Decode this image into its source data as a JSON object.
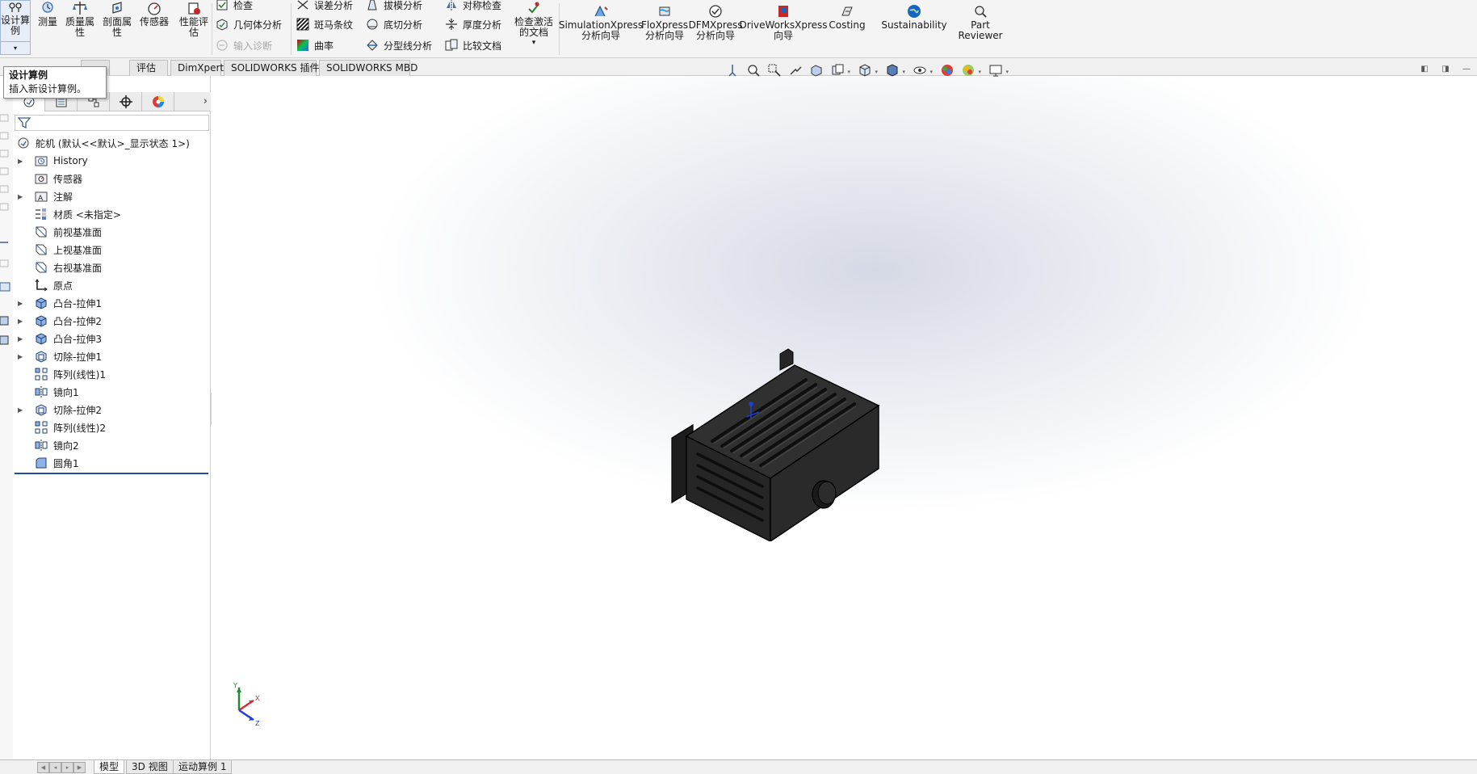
{
  "ribbon": {
    "design_table": {
      "label_lines": [
        "设计算",
        "例"
      ],
      "icon": "design-table-icon",
      "dropdown": "▾"
    },
    "big_buttons": [
      {
        "id": "measure",
        "icon": "measure-icon",
        "lines": [
          "测量"
        ]
      },
      {
        "id": "mass-properties",
        "icon": "mass-properties-icon",
        "lines": [
          "质量属",
          "性"
        ]
      },
      {
        "id": "section-properties",
        "icon": "section-properties-icon",
        "lines": [
          "剖面属",
          "性"
        ]
      },
      {
        "id": "sensor",
        "icon": "sensor-icon",
        "lines": [
          "传感器"
        ]
      },
      {
        "id": "performance-eval",
        "icon": "performance-icon",
        "lines": [
          "性能评",
          "估"
        ]
      }
    ],
    "small_col1": [
      {
        "id": "check",
        "icon": "check-icon",
        "label": "检查",
        "disabled": false
      },
      {
        "id": "geometry-analysis",
        "icon": "geometry-analysis-icon",
        "label": "几何体分析",
        "disabled": false
      },
      {
        "id": "import-diagnostics",
        "icon": "import-diagnostics-icon",
        "label": "输入诊断",
        "disabled": true
      }
    ],
    "small_col2": [
      {
        "id": "deviation-analysis",
        "icon": "deviation-icon",
        "label": "误差分析"
      },
      {
        "id": "zebra-stripes",
        "icon": "zebra-icon",
        "label": "斑马条纹"
      },
      {
        "id": "curvature",
        "icon": "curvature-icon",
        "label": "曲率"
      }
    ],
    "small_col3": [
      {
        "id": "draft-analysis",
        "icon": "draft-icon",
        "label": "拔模分析"
      },
      {
        "id": "undercut-analysis",
        "icon": "undercut-icon",
        "label": "底切分析"
      },
      {
        "id": "parting-line-analysis",
        "icon": "parting-line-icon",
        "label": "分型线分析"
      }
    ],
    "small_col4": [
      {
        "id": "symmetry-check",
        "icon": "symmetry-icon",
        "label": "对称检查"
      },
      {
        "id": "thickness-analysis",
        "icon": "thickness-icon",
        "label": "厚度分析"
      },
      {
        "id": "compare-documents",
        "icon": "compare-icon",
        "label": "比较文档"
      }
    ],
    "check_active_doc": {
      "icon": "check-active-doc-icon",
      "lines": [
        "检查激活",
        "的文档"
      ],
      "dropdown": "▾"
    },
    "xpress": [
      {
        "id": "simulationxpress",
        "icon": "simulationxpress-icon",
        "lines": [
          "SimulationXpress",
          "分析向导"
        ]
      },
      {
        "id": "floxpress",
        "icon": "floxpress-icon",
        "lines": [
          "FloXpress",
          "分析向导"
        ]
      },
      {
        "id": "dfmxpress",
        "icon": "dfmxpress-icon",
        "lines": [
          "DFMXpress",
          "分析向导"
        ]
      },
      {
        "id": "driveworksxpress",
        "icon": "driveworksxpress-icon",
        "lines": [
          "DriveWorksXpress",
          "向导"
        ]
      },
      {
        "id": "costing",
        "icon": "costing-icon",
        "lines": [
          "Costing"
        ]
      },
      {
        "id": "sustainability",
        "icon": "sustainability-icon",
        "lines": [
          "Sustainability"
        ]
      },
      {
        "id": "part-reviewer",
        "icon": "part-reviewer-icon",
        "lines": [
          "Part",
          "Reviewer"
        ]
      }
    ]
  },
  "command_tabs": [
    "评估",
    "DimXpert",
    "SOLIDWORKS 插件",
    "SOLIDWORKS MBD"
  ],
  "tooltip": {
    "title": "设计算例",
    "description": "插入新设计算例。"
  },
  "hud_toolbar": [
    "view-orientation-icon",
    "zoom-to-fit-icon",
    "zoom-to-area-icon",
    "previous-view-icon",
    "section-view-icon",
    "dynamic-annotation-icon",
    "view-orientation-cube-icon",
    "display-style-icon",
    "hide-show-items-icon",
    "edit-appearance-icon",
    "apply-scene-icon",
    "view-settings-icon"
  ],
  "feature_tree": {
    "root": {
      "label": "舵机  (默认<<默认>_显示状态 1>)",
      "icon": "part-icon"
    },
    "items": [
      {
        "label": "History",
        "icon": "history-folder-icon",
        "expandable": true
      },
      {
        "label": "传感器",
        "icon": "sensors-folder-icon",
        "expandable": false
      },
      {
        "label": "注解",
        "icon": "annotations-folder-icon",
        "expandable": true
      },
      {
        "label": "材质 <未指定>",
        "icon": "material-icon",
        "expandable": false
      },
      {
        "label": "前视基准面",
        "icon": "plane-icon",
        "expandable": false
      },
      {
        "label": "上视基准面",
        "icon": "plane-icon",
        "expandable": false
      },
      {
        "label": "右视基准面",
        "icon": "plane-icon",
        "expandable": false
      },
      {
        "label": "原点",
        "icon": "origin-icon",
        "expandable": false
      },
      {
        "label": "凸台-拉伸1",
        "icon": "boss-extrude-icon",
        "expandable": true
      },
      {
        "label": "凸台-拉伸2",
        "icon": "boss-extrude-icon",
        "expandable": true
      },
      {
        "label": "凸台-拉伸3",
        "icon": "boss-extrude-icon",
        "expandable": true
      },
      {
        "label": "切除-拉伸1",
        "icon": "cut-extrude-icon",
        "expandable": true
      },
      {
        "label": "阵列(线性)1",
        "icon": "linear-pattern-icon",
        "expandable": false
      },
      {
        "label": "镜向1",
        "icon": "mirror-icon",
        "expandable": false
      },
      {
        "label": "切除-拉伸2",
        "icon": "cut-extrude-icon",
        "expandable": true
      },
      {
        "label": "阵列(线性)2",
        "icon": "linear-pattern-icon",
        "expandable": false
      },
      {
        "label": "镜向2",
        "icon": "mirror-icon",
        "expandable": false
      },
      {
        "label": "圆角1",
        "icon": "fillet-icon",
        "expandable": false
      }
    ]
  },
  "bottom_tabs": [
    "模型",
    "3D 视图",
    "运动算例 1"
  ],
  "colors": {
    "accent": "#1f4e9a",
    "model_body": "#2a2a2a",
    "ribbon_bg": "#f4f4f4"
  }
}
